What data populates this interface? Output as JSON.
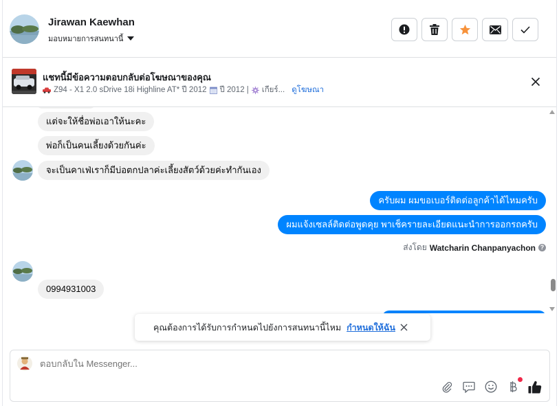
{
  "header": {
    "contact_name": "Jirawan Kaewhan",
    "assign_label": "มอบหมายการสนทนานี้",
    "actions": [
      "report-icon",
      "trash-icon",
      "star-icon",
      "envelope-icon",
      "check-icon"
    ],
    "star_color": "#f7923b"
  },
  "ad": {
    "title": "แชทนี้มีข้อความตอบกลับต่อโฆษณาของคุณ",
    "desc_model": "Z94 - X1 2.0 sDrive 18i Highline AT* ปี 2012",
    "desc_year": "ปี 2012 |",
    "desc_gear": "เกียร์...",
    "link": "ดูโฆษณา"
  },
  "thread": {
    "incoming": [
      "แต่จะให้ชื่อพ่อเอาให้นะคะ",
      "พ่อก็เป็นคนเลี้ยงด้วยกันค่ะ",
      "จะเป็นคาเฟ่เราก็มีบ่อตกปลาค่ะเลี้ยงสัตว์ด้วยค่ะทำกันเอง",
      "0994931003"
    ],
    "outgoing": [
      "ครับผม ผมขอเบอร์ติดต่อลูกค้าได้ไหมครับ",
      "ผมแจ้งเซลล์ติดต่อพูดคุย พาเช็ครายละเอียดแนะนำการออกรถครับ"
    ],
    "sent_by_prefix": "ส่งโดย",
    "sent_by_name": "Watcharin Chanpanyachon",
    "outgoing_color": "#0084ff"
  },
  "toast": {
    "text": "คุณต้องการได้รับการกำหนดไปยังการสนทนานี้ไหม",
    "link": "กำหนดให้ฉัน"
  },
  "composer": {
    "placeholder": "ตอบกลับใน Messenger...",
    "tools": [
      "paperclip-icon",
      "quick-reply-icon",
      "emoji-icon",
      "baht-icon",
      "thumbs-up-icon"
    ]
  }
}
